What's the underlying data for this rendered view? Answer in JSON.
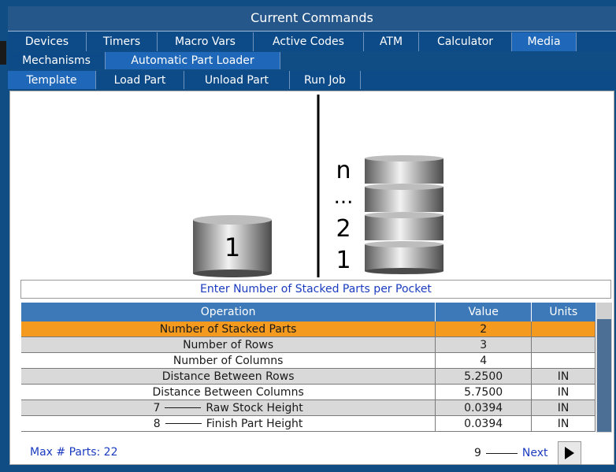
{
  "window": {
    "title": "Current Commands"
  },
  "tabs_row1": [
    "Devices",
    "Timers",
    "Macro Vars",
    "Active Codes",
    "ATM",
    "Calculator",
    "Media"
  ],
  "tabs_row2": [
    "Mechanisms",
    "Automatic Part Loader"
  ],
  "tabs_row3": [
    "Template",
    "Load Part",
    "Unload Part",
    "Run Job"
  ],
  "illustration": {
    "single_part_label": "1",
    "stack_labels": [
      "n",
      "...",
      "2",
      "1"
    ]
  },
  "instruction": "Enter Number of Stacked Parts per Pocket",
  "table": {
    "headers": [
      "Operation",
      "Value",
      "Units"
    ],
    "rows": [
      {
        "callout": "",
        "operation": "Number of Stacked Parts",
        "value": "2",
        "units": ""
      },
      {
        "callout": "",
        "operation": "Number of Rows",
        "value": "3",
        "units": ""
      },
      {
        "callout": "",
        "operation": "Number of Columns",
        "value": "4",
        "units": ""
      },
      {
        "callout": "",
        "operation": "Distance Between Rows",
        "value": "5.2500",
        "units": "IN"
      },
      {
        "callout": "",
        "operation": "Distance Between Columns",
        "value": "5.7500",
        "units": "IN"
      },
      {
        "callout": "7",
        "operation": "Raw Stock Height",
        "value": "0.0394",
        "units": "IN"
      },
      {
        "callout": "8",
        "operation": "Finish Part Height",
        "value": "0.0394",
        "units": "IN"
      }
    ]
  },
  "footer": {
    "max_parts": "Max # Parts: 22",
    "next_callout": "9",
    "next_label": "Next"
  },
  "colors": {
    "frame": "#0f4d84",
    "active_tab": "#1f67b8",
    "selected_row": "#f49a1f",
    "link_text": "#1a3bbf"
  },
  "icons": [
    "cylinder-part-icon",
    "stacked-parts-icon",
    "play-arrow-icon"
  ]
}
